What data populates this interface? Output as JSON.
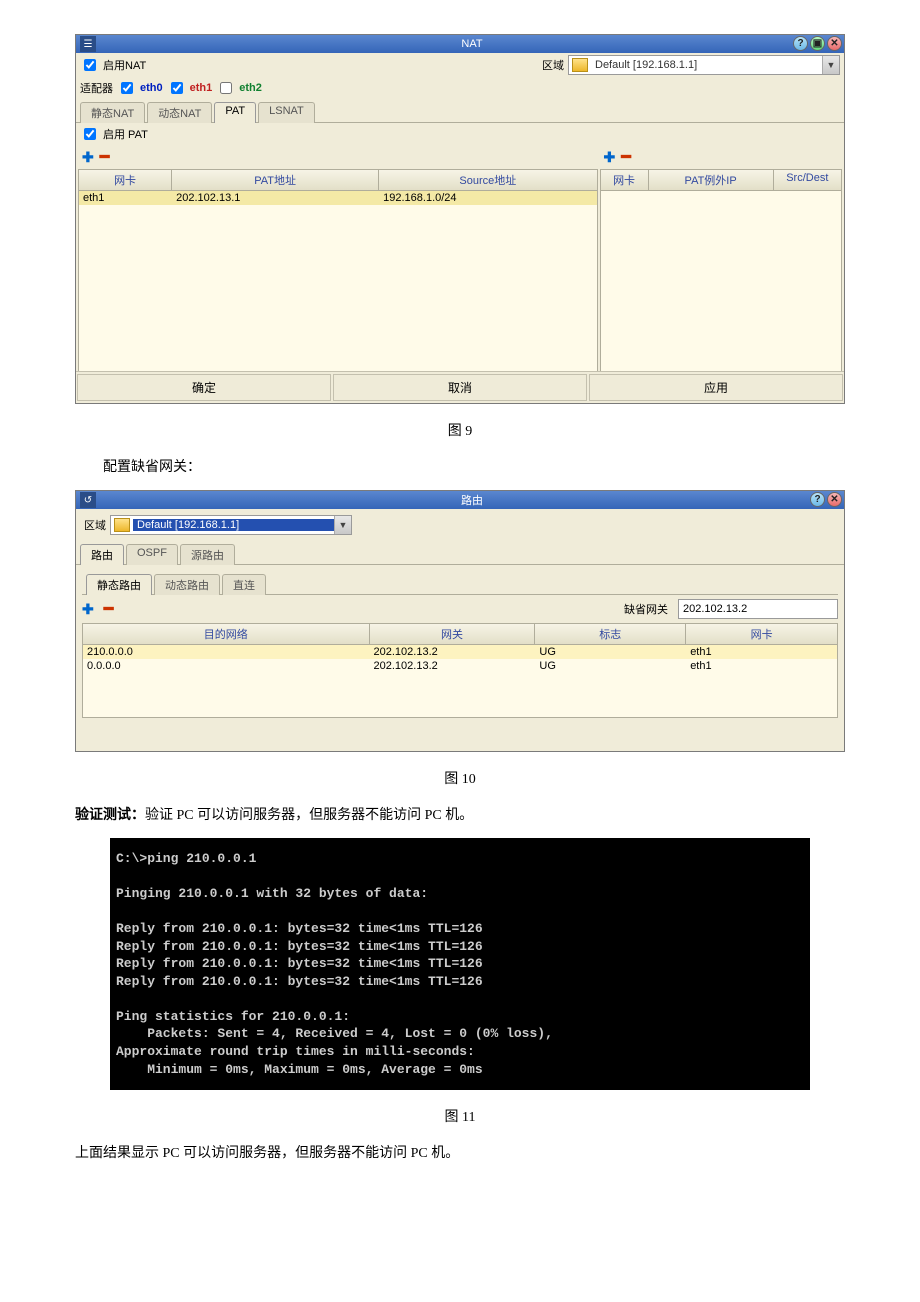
{
  "fig9": {
    "title": "NAT",
    "enable_nat_label": "启用NAT",
    "zone_label": "区域",
    "zone_value": "Default [192.168.1.1]",
    "adapters_label": "适配器",
    "adapters": {
      "eth0": "eth0",
      "eth1": "eth1",
      "eth2": "eth2"
    },
    "tabs": [
      "静态NAT",
      "动态NAT",
      "PAT",
      "LSNAT"
    ],
    "enable_pat_label": "启用 PAT",
    "left_cols": [
      "网卡",
      "PAT地址",
      "Source地址"
    ],
    "right_cols": [
      "网卡",
      "PAT例外IP",
      "Src/Dest"
    ],
    "left_row": {
      "nic": "eth1",
      "pat": "202.102.13.1",
      "src": "192.168.1.0/24"
    },
    "buttons": {
      "ok": "确定",
      "cancel": "取消",
      "apply": "应用"
    }
  },
  "caption9": "图 9",
  "para1": "配置缺省网关：",
  "fig10": {
    "title": "路由",
    "zone_label": "区域",
    "zone_value": "Default [192.168.1.1]",
    "outer_tabs": [
      "路由",
      "OSPF",
      "源路由"
    ],
    "inner_tabs": [
      "静态路由",
      "动态路由",
      "直连"
    ],
    "gateway_label": "缺省网关",
    "gateway_value": "202.102.13.2",
    "cols": [
      "目的网络",
      "网关",
      "标志",
      "网卡"
    ],
    "rows": [
      {
        "dest": "210.0.0.0",
        "gw": "202.102.13.2",
        "flag": "UG",
        "nic": "eth1"
      },
      {
        "dest": "0.0.0.0",
        "gw": "202.102.13.2",
        "flag": "UG",
        "nic": "eth1"
      }
    ]
  },
  "caption10": "图 10",
  "para2a": "验证测试：",
  "para2b": "验证 PC 可以访问服务器，但服务器不能访问 PC 机。",
  "console": "C:\\>ping 210.0.0.1\n\nPinging 210.0.0.1 with 32 bytes of data:\n\nReply from 210.0.0.1: bytes=32 time<1ms TTL=126\nReply from 210.0.0.1: bytes=32 time<1ms TTL=126\nReply from 210.0.0.1: bytes=32 time<1ms TTL=126\nReply from 210.0.0.1: bytes=32 time<1ms TTL=126\n\nPing statistics for 210.0.0.1:\n    Packets: Sent = 4, Received = 4, Lost = 0 (0% loss),\nApproximate round trip times in milli-seconds:\n    Minimum = 0ms, Maximum = 0ms, Average = 0ms",
  "caption11": "图 11",
  "para3": "上面结果显示 PC 可以访问服务器，但服务器不能访问 PC 机。"
}
